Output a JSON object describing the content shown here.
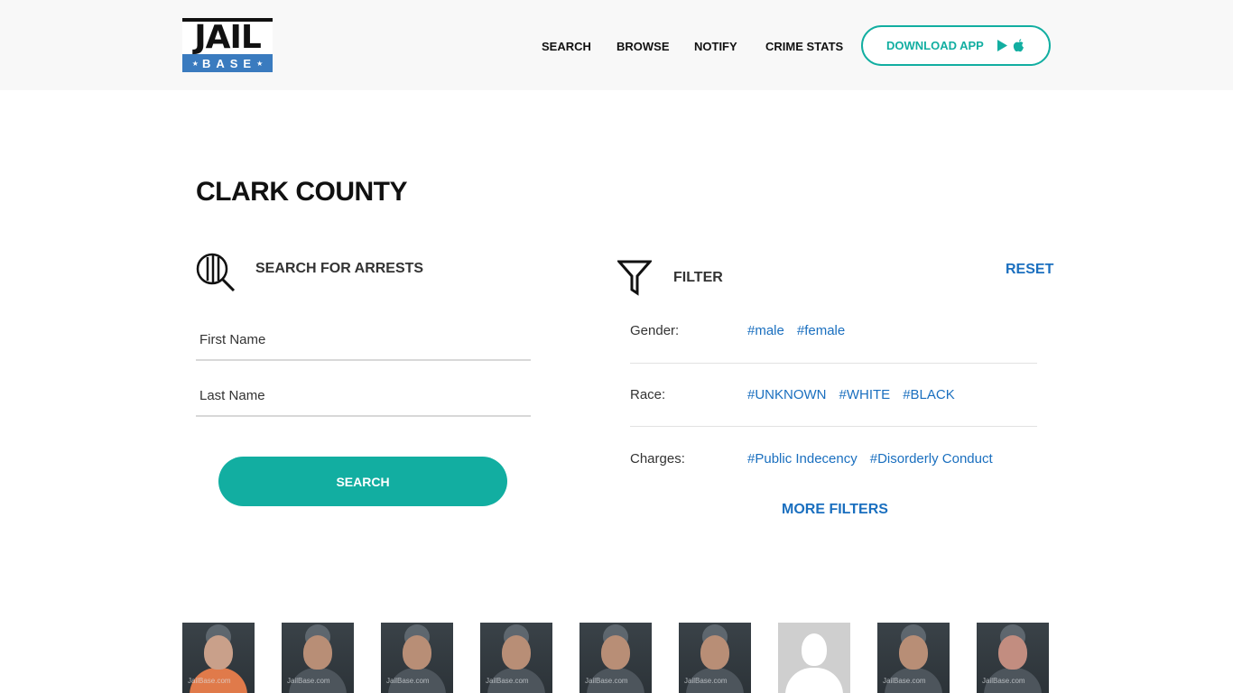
{
  "header": {
    "logo_top": "JAIL",
    "logo_bottom": "BASE",
    "nav": [
      "SEARCH",
      "BROWSE",
      "NOTIFY",
      "CRIME STATS"
    ],
    "download_label": "DOWNLOAD APP"
  },
  "page_title": "CLARK COUNTY",
  "search": {
    "heading": "SEARCH FOR ARRESTS",
    "first_name_placeholder": "First Name",
    "last_name_placeholder": "Last Name",
    "button": "SEARCH"
  },
  "filter": {
    "heading": "FILTER",
    "reset": "RESET",
    "rows": [
      {
        "label": "Gender:",
        "tags": [
          "#male",
          "#female"
        ]
      },
      {
        "label": "Race:",
        "tags": [
          "#UNKNOWN",
          "#WHITE",
          "#BLACK"
        ]
      },
      {
        "label": "Charges:",
        "tags": [
          "#Public Indecency",
          "#Disorderly Conduct"
        ]
      }
    ],
    "more": "MORE FILTERS"
  },
  "mugshots": {
    "watermark": "JailBase.com",
    "count": 9,
    "placeholder_index": 6
  },
  "colors": {
    "accent": "#12aea1",
    "link": "#1a6fbf",
    "logo_blue": "#3a7bbf"
  }
}
